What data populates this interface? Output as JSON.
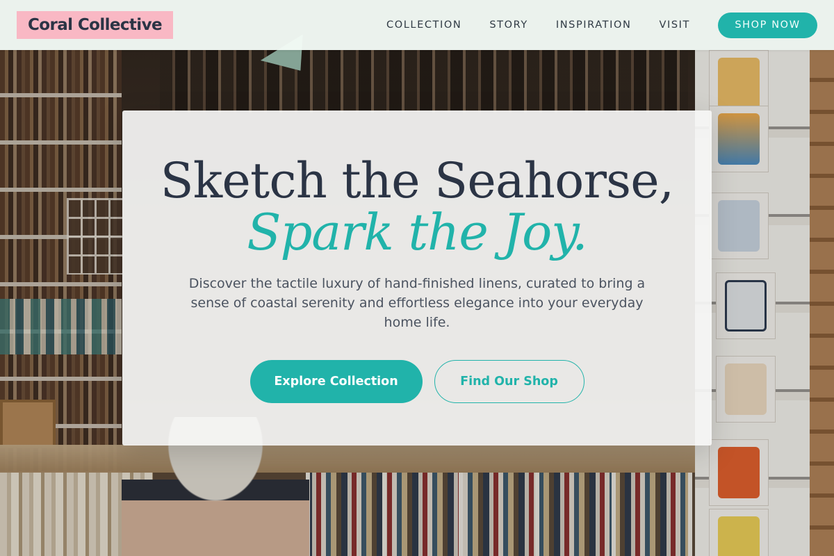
{
  "brand": {
    "name": "Coral Collective",
    "accent_color": "#21b3aa",
    "logo_bg": "#f9b8c4",
    "text_color": "#2b3445"
  },
  "nav": {
    "items": [
      {
        "label": "COLLECTION"
      },
      {
        "label": "STORY"
      },
      {
        "label": "INSPIRATION"
      },
      {
        "label": "VISIT"
      }
    ],
    "cta_label": "SHOP NOW"
  },
  "hero": {
    "headline": "Sketch the Seahorse,",
    "headline_accent": "Spark the Joy.",
    "description": "Discover the tactile luxury of hand-finished linens, curated to bring a sense of coastal serenity and effortless elegance into your everyday home life.",
    "primary_button": "Explore Collection",
    "secondary_button": "Find Our Shop",
    "background": "shop-interior-photo"
  }
}
